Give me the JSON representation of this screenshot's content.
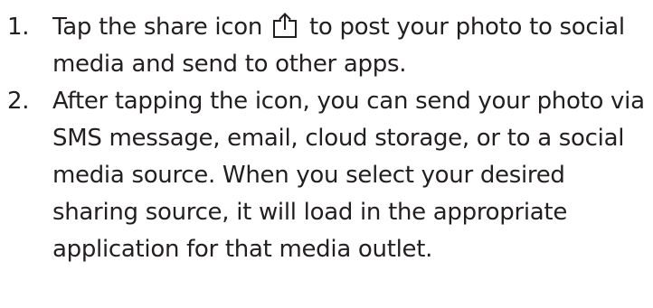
{
  "steps": [
    {
      "number": "1.",
      "text_before_icon": "Tap the share icon",
      "icon": "share-icon",
      "text_after_icon": "to post your photo to social media and send to other apps."
    },
    {
      "number": "2.",
      "text": "After tapping the icon, you can send your photo via SMS message, email, cloud storage, or to a social media source. When you select your desired sharing source, it will load in the appropriate application for that media outlet."
    }
  ],
  "colors": {
    "text": "#231f20",
    "background": "#ffffff"
  }
}
